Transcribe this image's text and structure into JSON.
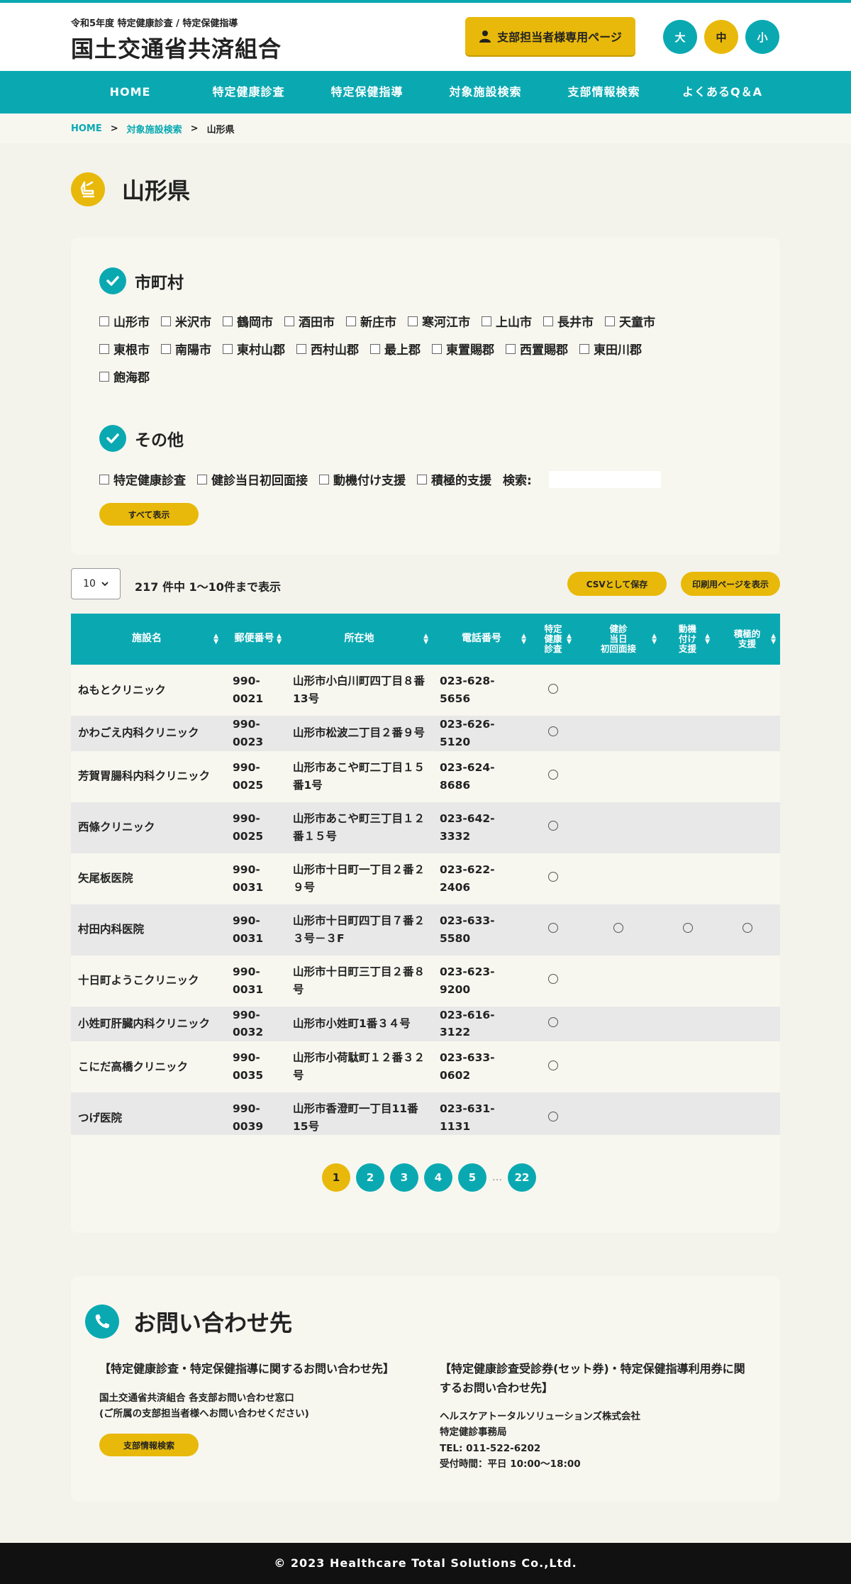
{
  "header": {
    "subtitle": "令和5年度 特定健康診査 / 特定保健指導",
    "site_title": "国土交通省共済組合",
    "member_button": "支部担当者様専用ページ",
    "font_sizes": [
      "大",
      "中",
      "小"
    ],
    "active_font_size": "中"
  },
  "nav": [
    "HOME",
    "特定健康診査",
    "特定保健指導",
    "対象施設検索",
    "支部情報検索",
    "よくあるQ＆A"
  ],
  "breadcrumb": {
    "home": "HOME",
    "sep": ">",
    "parent": "対象施設検索",
    "current": "山形県"
  },
  "page_title": "山形県",
  "filters": {
    "city_heading": "市町村",
    "cities_row1": [
      "山形市",
      "米沢市",
      "鶴岡市",
      "酒田市",
      "新庄市",
      "寒河江市",
      "上山市",
      "長井市",
      "天童市"
    ],
    "cities_row2": [
      "東根市",
      "南陽市",
      "東村山郡",
      "西村山郡",
      "最上郡",
      "東置賜郡",
      "西置賜郡",
      "東田川郡"
    ],
    "cities_row3": [
      "飽海郡"
    ],
    "other_heading": "その他",
    "others": [
      "特定健康診査",
      "健診当日初回面接",
      "動機付け支援",
      "積極的支援"
    ],
    "search_label": "検索:",
    "show_all_button": "すべて表示"
  },
  "controls": {
    "per_page": "10",
    "result_count": "217 件中 1〜10件まで表示",
    "csv_button": "CSVとして保存",
    "print_button": "印刷用ページを表示"
  },
  "table": {
    "headers": [
      "施設名",
      "郵便番号",
      "所在地",
      "電話番号",
      "特定\n健康\n診査",
      "健診\n当日\n初回面接",
      "動機\n付け\n支援",
      "積極的\n支援"
    ],
    "rows": [
      {
        "name": "ねもとクリニック",
        "zip": "990-0021",
        "address": "山形市小白川町四丁目８番13号",
        "tel": "023-628-5656",
        "c1": "○",
        "c2": "",
        "c3": "",
        "c4": ""
      },
      {
        "name": "かわごえ内科クリニック",
        "zip": "990-0023",
        "address": "山形市松波二丁目２番９号",
        "tel": "023-626-5120",
        "c1": "○",
        "c2": "",
        "c3": "",
        "c4": ""
      },
      {
        "name": "芳賀胃腸科内科クリニック",
        "zip": "990-0025",
        "address": "山形市あこや町二丁目１５番1号",
        "tel": "023-624-8686",
        "c1": "○",
        "c2": "",
        "c3": "",
        "c4": ""
      },
      {
        "name": "西條クリニック",
        "zip": "990-0025",
        "address": "山形市あこや町三丁目１２番１５号",
        "tel": "023-642-3332",
        "c1": "○",
        "c2": "",
        "c3": "",
        "c4": ""
      },
      {
        "name": "矢尾板医院",
        "zip": "990-0031",
        "address": "山形市十日町一丁目２番２９号",
        "tel": "023-622-2406",
        "c1": "○",
        "c2": "",
        "c3": "",
        "c4": ""
      },
      {
        "name": "村田内科医院",
        "zip": "990-0031",
        "address": "山形市十日町四丁目７番２３号－３F",
        "tel": "023-633-5580",
        "c1": "○",
        "c2": "○",
        "c3": "○",
        "c4": "○"
      },
      {
        "name": "十日町ようこクリニック",
        "zip": "990-0031",
        "address": "山形市十日町三丁目２番８号",
        "tel": "023-623-9200",
        "c1": "○",
        "c2": "",
        "c3": "",
        "c4": ""
      },
      {
        "name": "小姓町肝臓内科クリニック",
        "zip": "990-0032",
        "address": "山形市小姓町1番３４号",
        "tel": "023-616-3122",
        "c1": "○",
        "c2": "",
        "c3": "",
        "c4": ""
      },
      {
        "name": "こにだ高橋クリニック",
        "zip": "990-0035",
        "address": "山形市小荷駄町１２番３２号",
        "tel": "023-633-0602",
        "c1": "○",
        "c2": "",
        "c3": "",
        "c4": ""
      },
      {
        "name": "つげ医院",
        "zip": "990-0039",
        "address": "山形市香澄町一丁目11番15号",
        "tel": "023-631-1131",
        "c1": "○",
        "c2": "",
        "c3": "",
        "c4": ""
      }
    ]
  },
  "pagination": {
    "pages": [
      "1",
      "2",
      "3",
      "4",
      "5"
    ],
    "ellipsis": "…",
    "last": "22",
    "current": "1"
  },
  "contact": {
    "title": "お問い合わせ先",
    "left_heading": "【特定健康診査・特定保健指導に関するお問い合わせ先】",
    "left_line1": "国土交通省共済組合 各支部お問い合わせ窓口",
    "left_line2": "(ご所属の支部担当者様へお問い合わせください)",
    "left_button": "支部情報検索",
    "right_heading_1": "【特定健康診査受診券(セット券)・特定保健指導利用券に関",
    "right_heading_2": "するお問い合わせ先】",
    "right_line1": "ヘルスケアトータルソリューションズ株式会社",
    "right_line2": "特定健診事務局",
    "right_line3": "TEL: 011-522-6202",
    "right_line4": "受付時間：平日 10:00〜18:00"
  },
  "footer": "© 2023 Healthcare Total Solutions Co.,Ltd.",
  "colors": {
    "teal": "#0aa9b2",
    "yellow": "#e8b90a",
    "bg": "#f3f3ec"
  }
}
